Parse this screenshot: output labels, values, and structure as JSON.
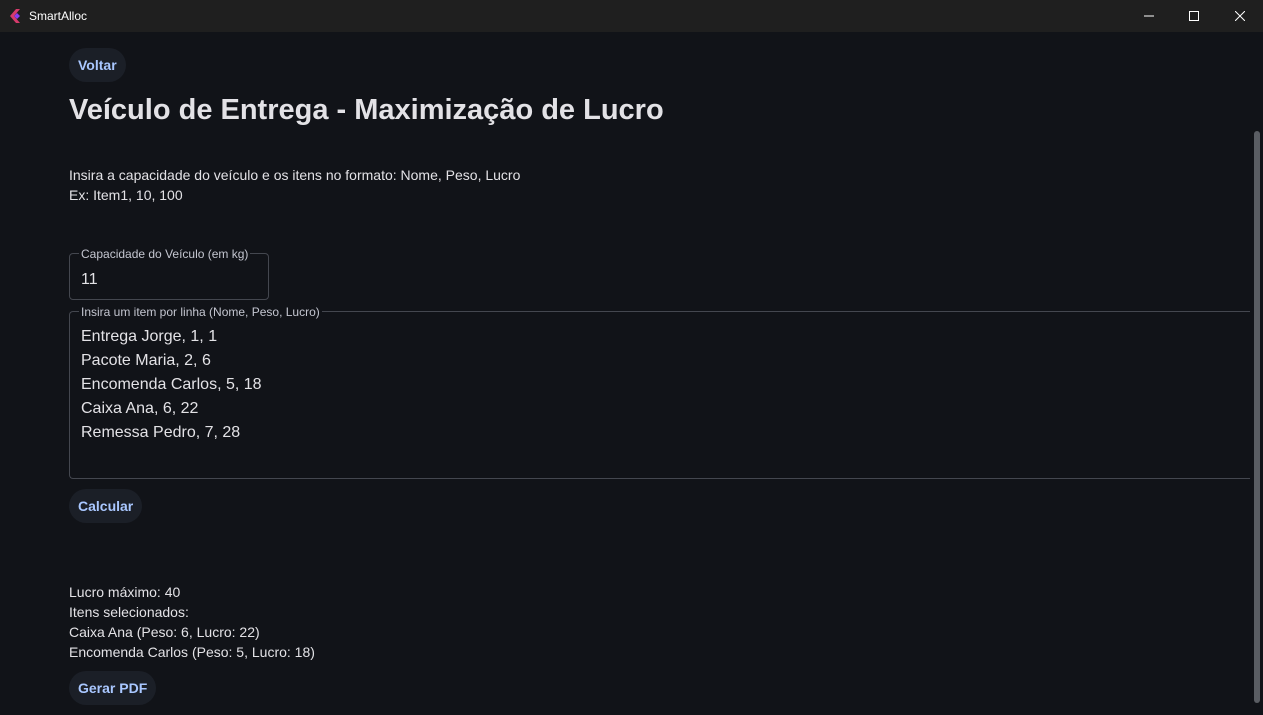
{
  "window": {
    "title": "SmartAlloc",
    "minimize_glyph": "—",
    "maximize_glyph": "☐",
    "close_glyph": "✕"
  },
  "back_button": {
    "label": "Voltar"
  },
  "page_title": "Veículo de Entrega - Maximização de Lucro",
  "instructions": {
    "line1": "Insira a capacidade do veículo e os itens no formato: Nome, Peso, Lucro",
    "line2": "Ex: Item1, 10, 100"
  },
  "capacity_field": {
    "label": "Capacidade do Veículo (em kg)",
    "value": "11"
  },
  "items_field": {
    "label": "Insira um item por linha (Nome, Peso, Lucro)",
    "lines": [
      "Entrega Jorge, 1, 1",
      "Pacote Maria, 2, 6",
      "Encomenda Carlos, 5, 18",
      "Caixa Ana, 6, 22",
      "Remessa Pedro, 7, 28"
    ]
  },
  "calculate_button": {
    "label": "Calcular"
  },
  "results": {
    "max_profit": "Lucro máximo: 40",
    "selected_heading": "Itens selecionados:",
    "selected_items": [
      "Caixa Ana (Peso: 6, Lucro: 22)",
      "Encomenda Carlos (Peso: 5, Lucro: 18)"
    ]
  },
  "pdf_button": {
    "label": "Gerar PDF"
  },
  "colors": {
    "background": "#111318",
    "titlebar": "#1f1f1f",
    "button_bg": "#1b1f27",
    "button_text": "#a9c7ff",
    "text": "#e3e2e6",
    "outline": "#44474f",
    "app_icon": "#d63a6b"
  }
}
